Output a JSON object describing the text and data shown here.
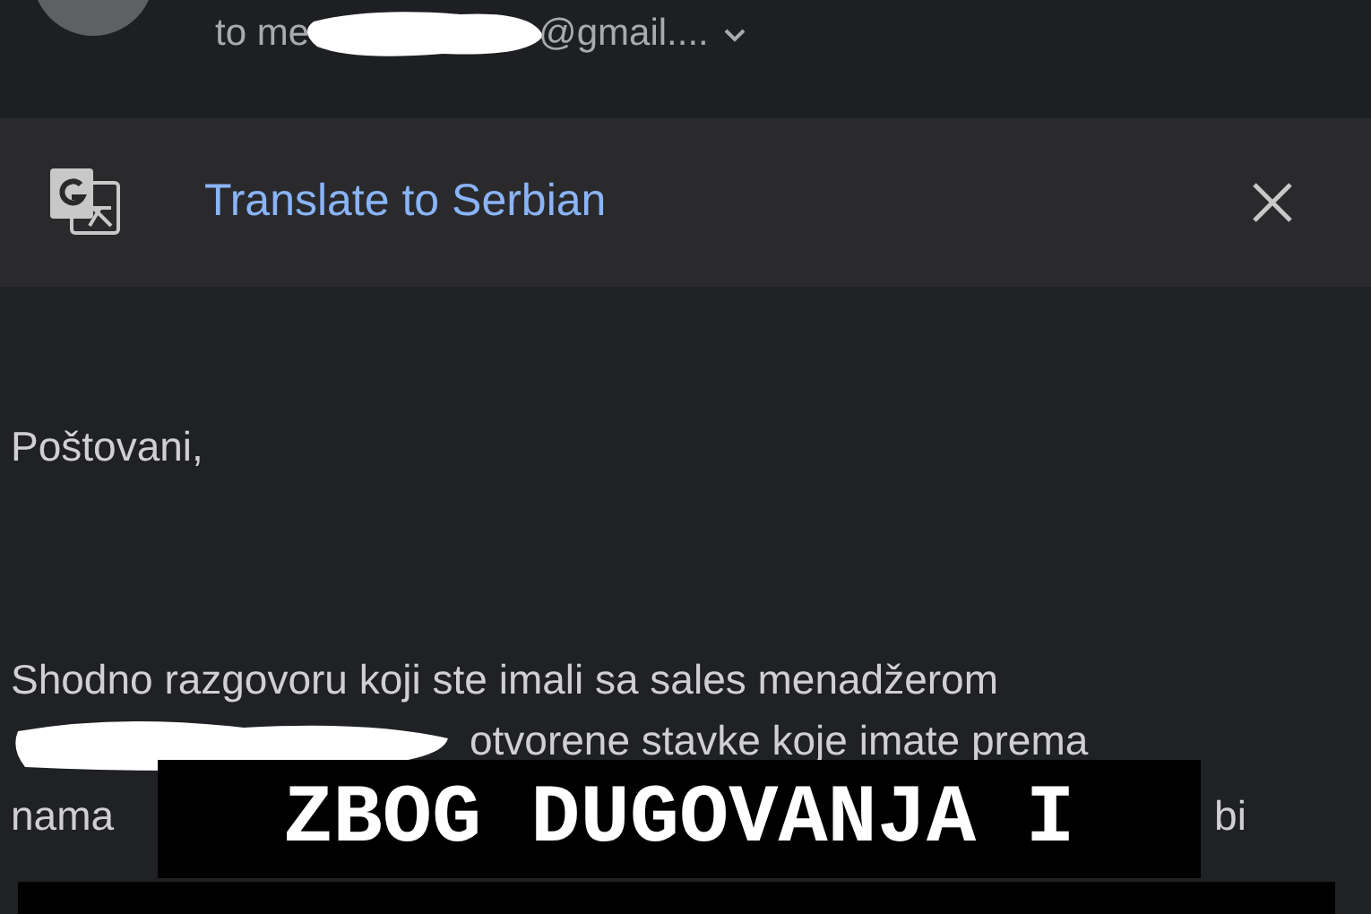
{
  "header": {
    "recipient_prefix": "to me",
    "recipient_suffix": "@gmail....",
    "details_expanded": false
  },
  "translate_bar": {
    "label": "Translate to Serbian"
  },
  "body": {
    "greeting": "Poštovani,",
    "lines": [
      "Shodno razgovoru koji ste imali sa sales menadžerom",
      "otvorene stavke koje imate prema"
    ],
    "line_3_start": "nama",
    "line_3_end": "bi"
  },
  "caption": {
    "text": "ZBOG DUGOVANJA I"
  }
}
